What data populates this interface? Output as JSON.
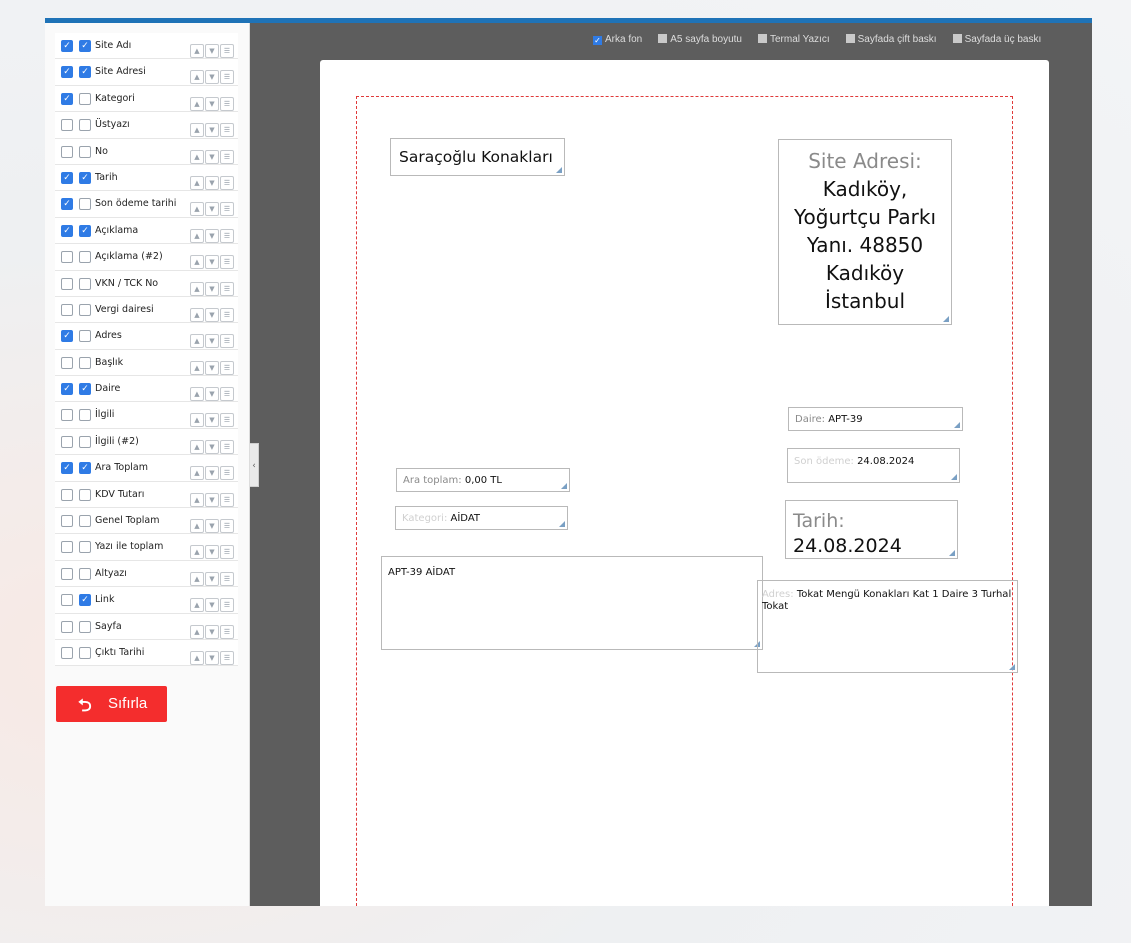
{
  "fields": [
    {
      "label": "Site Adı",
      "a": true,
      "b": true
    },
    {
      "label": "Site Adresi",
      "a": true,
      "b": true
    },
    {
      "label": "Kategori",
      "a": true,
      "b": false
    },
    {
      "label": "Üstyazı",
      "a": false,
      "b": false
    },
    {
      "label": "No",
      "a": false,
      "b": false
    },
    {
      "label": "Tarih",
      "a": true,
      "b": true
    },
    {
      "label": "Son ödeme tarihi",
      "a": true,
      "b": false
    },
    {
      "label": "Açıklama",
      "a": true,
      "b": true
    },
    {
      "label": "Açıklama (#2)",
      "a": false,
      "b": false
    },
    {
      "label": "VKN / TCK No",
      "a": false,
      "b": false
    },
    {
      "label": "Vergi dairesi",
      "a": false,
      "b": false
    },
    {
      "label": "Adres",
      "a": true,
      "b": false
    },
    {
      "label": "Başlık",
      "a": false,
      "b": false
    },
    {
      "label": "Daire",
      "a": true,
      "b": true
    },
    {
      "label": "İlgili",
      "a": false,
      "b": false
    },
    {
      "label": "İlgili (#2)",
      "a": false,
      "b": false
    },
    {
      "label": "Ara Toplam",
      "a": true,
      "b": true
    },
    {
      "label": "KDV Tutarı",
      "a": false,
      "b": false
    },
    {
      "label": "Genel Toplam",
      "a": false,
      "b": false
    },
    {
      "label": "Yazı ile toplam",
      "a": false,
      "b": false
    },
    {
      "label": "Altyazı",
      "a": false,
      "b": false
    },
    {
      "label": "Link",
      "a": false,
      "b": true
    },
    {
      "label": "Sayfa",
      "a": false,
      "b": false
    },
    {
      "label": "Çıktı Tarihi",
      "a": false,
      "b": false
    }
  ],
  "reset_label": "Sıfırla",
  "options": [
    {
      "label": "Arka fon",
      "checked": true
    },
    {
      "label": "A5 sayfa boyutu",
      "checked": false
    },
    {
      "label": "Termal Yazıcı",
      "checked": false
    },
    {
      "label": "Sayfada çift baskı",
      "checked": false
    },
    {
      "label": "Sayfada üç baskı",
      "checked": false
    }
  ],
  "document": {
    "site_name": "Saraçoğlu Konakları",
    "site_address_label": "Site Adresi:",
    "site_address_lines": [
      "Kadıköy,",
      "Yoğurtçu Parkı",
      "Yanı. 48850",
      "Kadıköy",
      "İstanbul"
    ],
    "daire_label": "Daire:",
    "daire_value": "APT-39",
    "son_odeme_label": "Son ödeme:",
    "son_odeme_value": "24.08.2024",
    "ara_toplam_label": "Ara toplam:",
    "ara_toplam_value": "0,00 TL",
    "kategori_label": "Kategori:",
    "kategori_value": "AİDAT",
    "tarih_label": "Tarih:",
    "tarih_value": "24.08.2024",
    "aciklama_value": "APT-39 AİDAT",
    "adres_label": "Adres:",
    "adres_value": "Tokat Mengü Konakları Kat 1 Daire 3 Turhal Tokat"
  }
}
